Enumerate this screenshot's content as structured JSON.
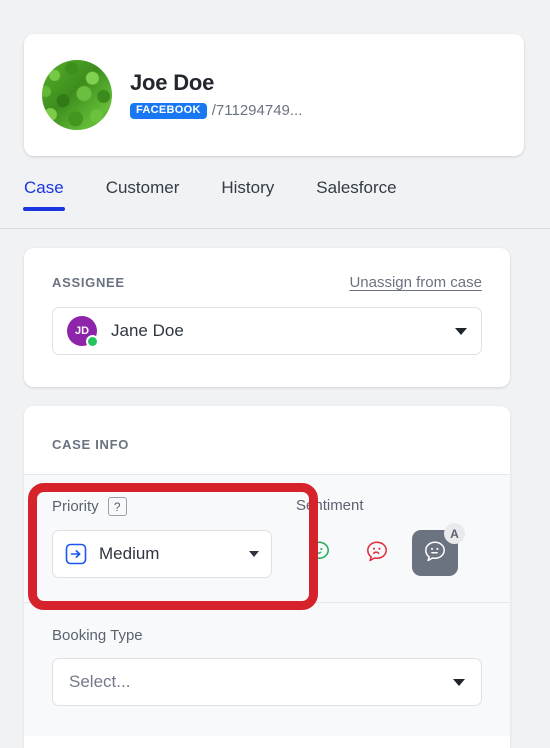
{
  "colors": {
    "page_bg": "#f1f2f4",
    "accent_blue": "#1836e0",
    "facebook_blue": "#1877f2",
    "annotation_red": "#d6232b",
    "avatar_purple": "#8e24aa",
    "presence_green": "#22c55e",
    "sentiment_positive": "#1faa55",
    "sentiment_negative": "#e02b3a",
    "sentiment_selected_bg": "#6b7280"
  },
  "contact": {
    "avatar_icon": "contact-photo-avatar",
    "name": "Joe Doe",
    "channel_badge": "FACEBOOK",
    "handle": "/711294749..."
  },
  "tabs": [
    {
      "label": "Case",
      "active": true
    },
    {
      "label": "Customer",
      "active": false
    },
    {
      "label": "History",
      "active": false
    },
    {
      "label": "Salesforce",
      "active": false
    }
  ],
  "assignee": {
    "section_label": "ASSIGNEE",
    "unassign_label": "Unassign from case",
    "selected": {
      "initials": "JD",
      "name": "Jane Doe",
      "presence": "online"
    },
    "caret_icon": "chevron-down-icon"
  },
  "case_info": {
    "section_label": "CASE INFO",
    "priority": {
      "label": "Priority",
      "help_glyph": "?",
      "value": "Medium",
      "value_icon": "arrow-right-boxed-icon",
      "caret_icon": "chevron-down-icon"
    },
    "sentiment": {
      "label": "Sentiment",
      "options": [
        {
          "name": "positive",
          "icon": "smiley-happy-bubble-icon",
          "selected": false
        },
        {
          "name": "negative",
          "icon": "smiley-sad-bubble-icon",
          "selected": false
        },
        {
          "name": "neutral",
          "icon": "smiley-neutral-bubble-icon",
          "selected": true,
          "badge": "A"
        }
      ]
    },
    "booking_type": {
      "label": "Booking Type",
      "value": "",
      "placeholder": "Select...",
      "caret_icon": "chevron-down-icon"
    }
  },
  "annotation": {
    "target": "priority-field",
    "shape": "rounded-rectangle",
    "color": "#d6232b"
  }
}
